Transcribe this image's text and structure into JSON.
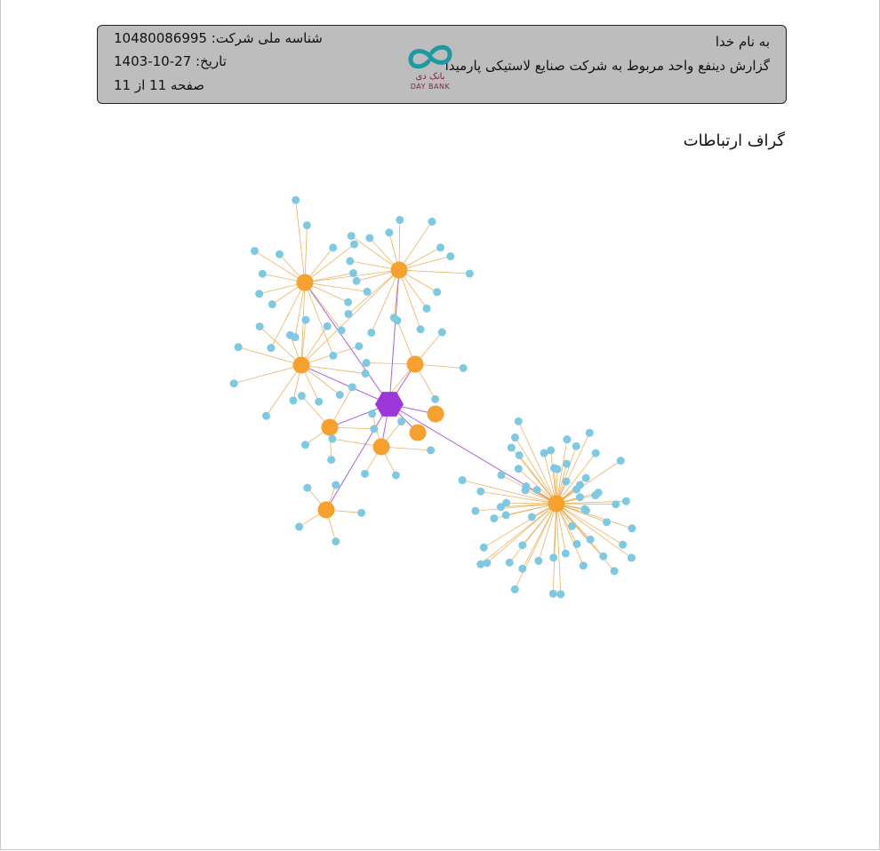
{
  "header": {
    "bismillah": "به نام خدا",
    "report_title": "گزارش دینفع واحد مربوط به شرکت صنایع لاستیکی پارمیدا",
    "national_id_label": "شناسه ملی شرکت: 10480086995",
    "date_label": "تاریخ: 27-10-1403",
    "page_label": "صفحه 11 از 11",
    "logo_fa": "بانک دی",
    "logo_en": "DAY BANK"
  },
  "section": {
    "title": "گراف ارتباطات"
  },
  "colors": {
    "center_node": "#9b37d8",
    "hub_node": "#f6a02d",
    "leaf_node": "#7ec9e2",
    "edge_orange": "#e9a445",
    "edge_purple": "#9a45d6",
    "logo_teal": "#1b9aa3",
    "logo_maroon": "#7a2a3a"
  }
}
